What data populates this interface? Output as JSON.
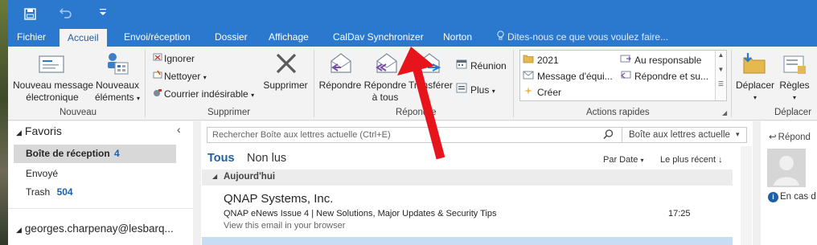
{
  "titlebar": {
    "save_icon": "save-icon",
    "undo_icon": "undo-icon",
    "qat_more_icon": "customize-qat-icon"
  },
  "tabs": [
    {
      "label": "Fichier"
    },
    {
      "label": "Accueil"
    },
    {
      "label": "Envoi/réception"
    },
    {
      "label": "Dossier"
    },
    {
      "label": "Affichage"
    },
    {
      "label": "CalDav Synchronizer"
    },
    {
      "label": "Norton"
    }
  ],
  "tell_me": "Dites-nous ce que vous voulez faire...",
  "ribbon": {
    "nouveau": {
      "new_message_1": "Nouveau message",
      "new_message_2": "électronique",
      "new_items_1": "Nouveaux",
      "new_items_2": "éléments",
      "group_label": "Nouveau"
    },
    "supprimer": {
      "ignore": "Ignorer",
      "clean": "Nettoyer",
      "junk": "Courrier indésirable",
      "delete": "Supprimer",
      "group_label": "Supprimer"
    },
    "repondre": {
      "reply": "Répondre",
      "reply_all_1": "Répondre",
      "reply_all_2": "à tous",
      "forward": "Transférer",
      "meeting": "Réunion",
      "more": "Plus",
      "group_label": "Répondre"
    },
    "actions_rapides": {
      "items": [
        "2021",
        "Message d'équi...",
        "Créer",
        "Au responsable",
        "Répondre et su..."
      ],
      "group_label": "Actions rapides"
    },
    "deplacer": {
      "move": "Déplacer",
      "rules": "Règles",
      "group_label": "Déplacer"
    }
  },
  "nav": {
    "favorites": "Favoris",
    "inbox": "Boîte de réception",
    "inbox_count": "4",
    "sent": "Envoyé",
    "trash": "Trash",
    "trash_count": "504",
    "account": "georges.charpenay@lesbarq..."
  },
  "search": {
    "placeholder": "Rechercher Boîte aux lettres actuelle (Ctrl+E)",
    "scope": "Boîte aux lettres actuelle"
  },
  "list": {
    "filter_all": "Tous",
    "filter_unread": "Non lus",
    "sort_by": "Par Date",
    "sort_order": "Le plus récent",
    "group_today": "Aujourd'hui",
    "emails": [
      {
        "sender": "QNAP Systems, Inc.",
        "subject": "QNAP eNews Issue 4 | New Solutions, Major Updates & Security Tips",
        "time": "17:25",
        "preview": "View this email in your browser"
      }
    ]
  },
  "reading": {
    "reply": "Répond",
    "info": "En cas d"
  },
  "annotation": {
    "arrow_color": "#e8141b"
  },
  "colors": {
    "accent": "#2b79cf",
    "selected": "#c8dcf2",
    "count": "#1e5fa8"
  }
}
